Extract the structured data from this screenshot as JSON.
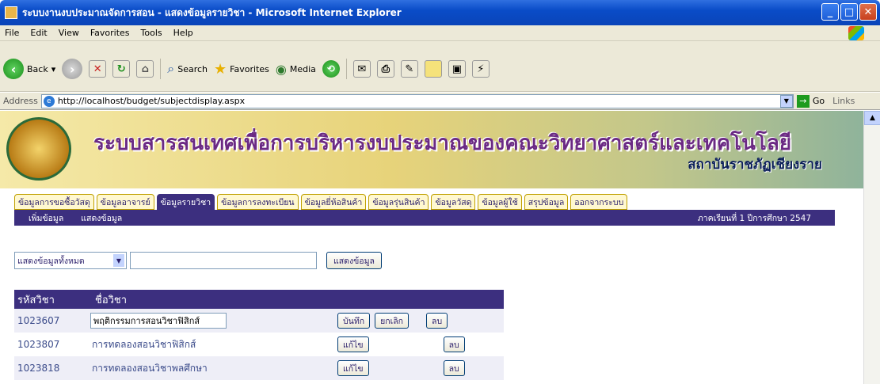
{
  "window": {
    "title": "ระบบงานงบประมาณจัดการสอน - แสดงข้อมูลรายวิชา - Microsoft Internet Explorer",
    "controls": [
      "_",
      "□",
      "✕"
    ]
  },
  "menubar": {
    "items": [
      "File",
      "Edit",
      "View",
      "Favorites",
      "Tools",
      "Help"
    ]
  },
  "toolbar": {
    "back": "Back",
    "search": "Search",
    "favorites": "Favorites",
    "media": "Media"
  },
  "address": {
    "label": "Address",
    "url": "http://localhost/budget/subjectdisplay.aspx",
    "go": "Go",
    "links": "Links"
  },
  "banner": {
    "title": "ระบบสารสนเทศเพื่อการบริหารงบประมาณของคณะวิทยาศาสตร์และเทคโนโลยี",
    "subtitle": "สถาบันราชภัฏเชียงราย"
  },
  "tabs": [
    {
      "label": "ข้อมูลการขอซื้อวัสดุ"
    },
    {
      "label": "ข้อมูลอาจารย์"
    },
    {
      "label": "ข้อมูลรายวิชา",
      "active": true
    },
    {
      "label": "ข้อมูลการลงทะเบียน"
    },
    {
      "label": "ข้อมูลยี่ห้อสินค้า"
    },
    {
      "label": "ข้อมูลรุ่นสินค้า"
    },
    {
      "label": "ข้อมูลวัสดุ"
    },
    {
      "label": "ข้อมูลผู้ใช้"
    },
    {
      "label": "สรุปข้อมูล"
    },
    {
      "label": "ออกจากระบบ"
    }
  ],
  "subnav": {
    "add": "เพิ่มข้อมูล",
    "show": "แสดงข้อมูล",
    "semester": "ภาคเรียนที่ 1 ปีการศึกษา 2547"
  },
  "filter": {
    "select_value": "แสดงข้อมูลทั้งหมด",
    "button": "แสดงข้อมูล"
  },
  "table": {
    "headers": [
      "รหัสวิชา",
      "ชื่อวิชา"
    ],
    "rows": [
      {
        "code": "1023607",
        "name": "พฤติกรรมการสอนวิชาฟิสิกส์",
        "editing": true,
        "save": "บันทึก",
        "cancel": "ยกเลิก",
        "delete": "ลบ"
      },
      {
        "code": "1023807",
        "name": "การทดลองสอนวิชาฟิสิกส์",
        "edit": "แก้ไข",
        "delete": "ลบ"
      },
      {
        "code": "1023818",
        "name": "การทดลองสอนวิชาพลศึกษา",
        "edit": "แก้ไข",
        "delete": "ลบ"
      }
    ]
  }
}
